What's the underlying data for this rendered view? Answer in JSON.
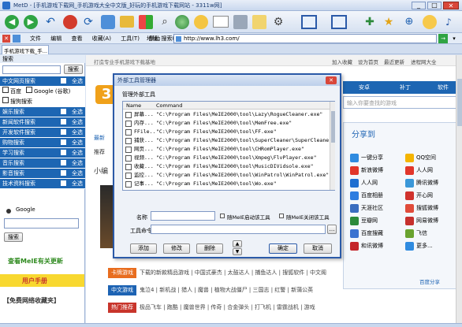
{
  "window": {
    "title": "MetD - [手机游戏下载网_手机游戏大全中文版_好玩的手机游戏下载网站 - 3311w网]"
  },
  "menu": {
    "items": [
      "文件",
      "编辑",
      "查看",
      "收藏(A)",
      "工具(T)",
      "帮助"
    ],
    "address_label": "地址, 搜索(B):",
    "address_value": "http://www.lh3.com/"
  },
  "tab": {
    "label": "手机游戏下载_手..."
  },
  "sidebar": {
    "title": "搜索",
    "search_button": "搜索",
    "rows": [
      {
        "label": "中文网页搜索",
        "all": "全选"
      },
      {
        "label": "百度",
        "google": "Google (谷歌)"
      },
      {
        "label": "搜狗搜索"
      },
      {
        "label": "娱乐搜索",
        "all": "全选"
      },
      {
        "label": "新闻软件搜索",
        "all": "全选"
      },
      {
        "label": "开发软件搜索",
        "all": "全选"
      },
      {
        "label": "购物搜索",
        "all": "全选"
      },
      {
        "label": "学习搜索",
        "all": "全选"
      },
      {
        "label": "音乐搜索",
        "all": "全选"
      },
      {
        "label": "影音搜索",
        "all": "全选"
      },
      {
        "label": "技术资料搜索",
        "all": "全选"
      }
    ],
    "google_label": "Google",
    "search_button2": "搜索",
    "promo1": "查看MeIE有关更新",
    "promo2": "用户手册",
    "promo3": "【免费网络收藏夹】"
  },
  "page": {
    "breadcrumb": "打造专业手机游戏下载基地",
    "top_links": [
      "加入收藏",
      "设为首页",
      "最近更新",
      "进程网大全"
    ],
    "tabs": [
      "安卓",
      "补丁",
      "软件"
    ],
    "search_placeholder": "输入你要查找的游戏",
    "share_title": "分享到",
    "share_items": [
      {
        "left": "一键分享",
        "right": "QQ空间",
        "lc": "#2f8be0",
        "rc": "#f4b400"
      },
      {
        "left": "新浪微博",
        "right": "人人网",
        "lc": "#e2362a",
        "rc": "#e2362a"
      },
      {
        "left": "人人网",
        "right": "腾讯微博",
        "lc": "#1f6fd1",
        "rc": "#3a97d8"
      },
      {
        "left": "百度相册",
        "right": "开心网",
        "lc": "#2e7de0",
        "rc": "#d0322d"
      },
      {
        "left": "天涯社区",
        "right": "搜狐微博",
        "lc": "#3a6dbf",
        "rc": "#e04b3a"
      },
      {
        "left": "豆瓣网",
        "right": "网易微博",
        "lc": "#2c8a3b",
        "rc": "#c6302d"
      },
      {
        "left": "百度搜藏",
        "right": "飞信",
        "lc": "#3b73d0",
        "rc": "#6aa32f"
      },
      {
        "left": "和讯微博",
        "right": "更多...",
        "lc": "#c4252a",
        "rc": "#2f8be0"
      }
    ],
    "bottom_link": "百度分享",
    "left_blocks": [
      "最新",
      "推荐",
      "小编"
    ],
    "categories": [
      {
        "tag": "卡牌游戏",
        "color": "#e86d1f",
        "text": "下载的新款精品游戏 | 中国式豪杰 | 太鼓达人 | 捕鱼达人 | 搜狐软件 | 中文阁"
      },
      {
        "tag": "中文游戏",
        "color": "#1d63b3",
        "text": "鬼泣4 | 新机战 | 猎人 | 魔兽 | 植物大战僵尸 | 三国志 | 红警 | 新蒲公英"
      },
      {
        "tag": "热门推荐",
        "color": "#c8352b",
        "text": "极品飞车 | 跑酷 | 魔兽世界 | 传奇 | 合金弹头 | 打飞机 | 雷霆战机 | 游戏"
      }
    ]
  },
  "dialog": {
    "title": "外部工具管理器",
    "subtitle": "管理外部工具",
    "col_name": "Name",
    "col_command": "Command",
    "rows": [
      {
        "name": "屏幕...",
        "command": "\"C:\\Program Files\\MeIE2000\\tool\\Lazy\\RogueCleaner.exe\""
      },
      {
        "name": "内存...",
        "command": "\"C:\\Program Files\\MeIE2000\\tool\\MemFree.exe\""
      },
      {
        "name": "FFile...",
        "command": "\"C:\\Program Files\\MeIE2000\\tool\\FF.exe\""
      },
      {
        "name": "捕获...",
        "command": "\"C:\\Program Files\\MeIE2000\\tool\\SuperCleaner\\SuperCleane...\""
      },
      {
        "name": "网页...",
        "command": "\"C:\\Program Files\\MeIE2000\\tool\\CHRomPlayer.exe\""
      },
      {
        "name": "视频...",
        "command": "\"C:\\Program Files\\MeIE2000\\tool\\Xmpeg\\FlvPlayer.exe\""
      },
      {
        "name": "收藏...",
        "command": "\"C:\\Program Files\\MeIE2000\\tool\\MusicDIVidsole.exe\""
      },
      {
        "name": "监控...",
        "command": "\"C:\\Program Files\\MeIE2000\\tool\\WinPatrol\\WinPatrol.exe\""
      },
      {
        "name": "记事...",
        "command": "\"C:\\Program Files\\MeIE2000\\tool\\Wo.exe\""
      }
    ],
    "name_label": "名称",
    "check1": "随MeIE启动该工具",
    "check2": "随MeIE关闭该工具",
    "tool_label": "工具命令",
    "btn_add": "添加",
    "btn_modify": "修改",
    "btn_delete": "删除",
    "btn_ok": "确定",
    "btn_cancel": "取消"
  },
  "colors": {
    "accent": "#1d66b3",
    "toolbar": "#dfe8f5",
    "dialog_border": "#2b5aa8"
  }
}
